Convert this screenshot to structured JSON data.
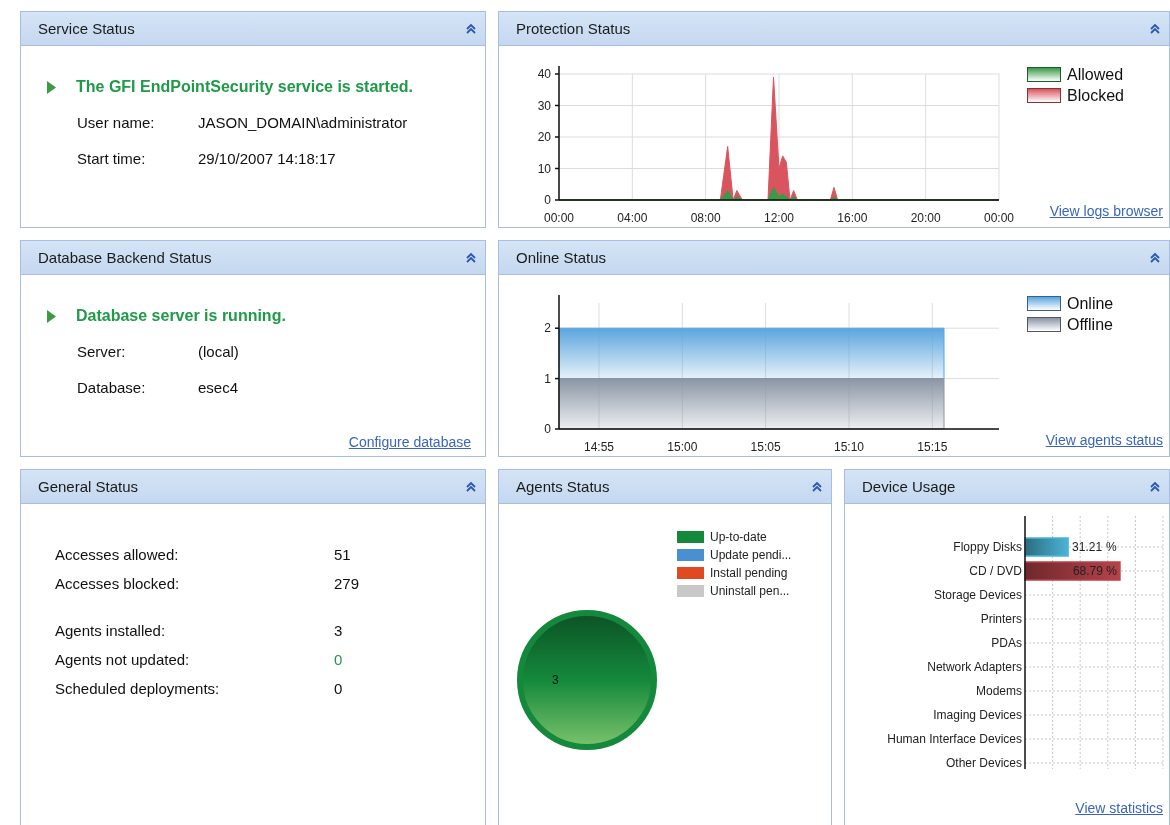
{
  "panels": [
    {
      "kind": "service",
      "title": "Service Status",
      "status_message": "The GFI EndPointSecurity service is started.",
      "fields": [
        {
          "label": "User name:",
          "value": "JASON_DOMAIN\\administrator"
        },
        {
          "label": "Start time:",
          "value": "29/10/2007 14:18:17"
        }
      ]
    },
    {
      "kind": "area_chart",
      "title": "Protection Status",
      "link": "View logs browser",
      "chart_data": {
        "type": "area",
        "grid": true,
        "x": [
          0,
          8.8,
          9.2,
          9.5,
          9.7,
          10,
          11.4,
          11.7,
          12,
          12.2,
          12.4,
          12.6,
          12.8,
          13,
          14.8,
          15,
          15.2,
          24
        ],
        "xlim": [
          0,
          24
        ],
        "ylim": [
          0,
          40
        ],
        "xticks": [
          {
            "value": 0,
            "label": "00:00"
          },
          {
            "value": 4,
            "label": "04:00"
          },
          {
            "value": 8,
            "label": "08:00"
          },
          {
            "value": 12,
            "label": "12:00"
          },
          {
            "value": 16,
            "label": "16:00"
          },
          {
            "value": 20,
            "label": "20:00"
          },
          {
            "value": 24,
            "label": "00:00"
          }
        ],
        "yticks": [
          0,
          10,
          20,
          30,
          40
        ],
        "series": [
          {
            "name": "Allowed",
            "color": "#3a9a4a",
            "values": [
              0,
              0,
              3,
              0,
              1,
              0,
              0,
              4,
              1,
              2,
              1,
              0,
              1,
              0,
              0,
              1,
              0,
              0
            ]
          },
          {
            "name": "Blocked",
            "color": "#d9545e",
            "values": [
              0,
              0,
              17,
              0,
              3,
              0,
              0,
              39,
              10,
              14,
              12,
              0,
              3,
              0,
              0,
              4,
              0,
              0
            ]
          }
        ]
      }
    },
    {
      "kind": "service",
      "title": "Database Backend Status",
      "status_message": "Database server is running.",
      "fields": [
        {
          "label": "Server:",
          "value": "(local)"
        },
        {
          "label": "Database:",
          "value": "esec4"
        }
      ],
      "link": "Configure database"
    },
    {
      "kind": "area_chart",
      "title": "Online Status",
      "link": "View agents status",
      "chart_data": {
        "type": "area",
        "grid": true,
        "x": [
          14.8767,
          15.2617
        ],
        "xlim": [
          14.8767,
          15.3167
        ],
        "ylim": [
          0,
          2.5
        ],
        "stacked": true,
        "xticks": [
          {
            "value": 14.9167,
            "label": "14:55"
          },
          {
            "value": 15,
            "label": "15:00"
          },
          {
            "value": 15.0833,
            "label": "15:05"
          },
          {
            "value": 15.1667,
            "label": "15:10"
          },
          {
            "value": 15.25,
            "label": "15:15"
          }
        ],
        "yticks": [
          0,
          1,
          2
        ],
        "series": [
          {
            "name": "Online",
            "color": "#5aa5de",
            "values": [
              1,
              1
            ]
          },
          {
            "name": "Offline",
            "color": "#8a95a5",
            "values": [
              1,
              1
            ]
          }
        ]
      }
    },
    {
      "kind": "counts",
      "title": "General Status",
      "groups": [
        [
          {
            "label": "Accesses allowed:",
            "value": "51",
            "accent": false
          },
          {
            "label": "Accesses blocked:",
            "value": "279",
            "accent": false
          }
        ],
        [
          {
            "label": "Agents installed:",
            "value": "3",
            "accent": false
          },
          {
            "label": "Agents not updated:",
            "value": "0",
            "accent": true
          },
          {
            "label": "Scheduled deployments:",
            "value": "0",
            "accent": false
          }
        ]
      ]
    },
    {
      "kind": "pie_chart",
      "title": "Agents Status",
      "legend": [
        {
          "label": "Up-to-date",
          "color": "#14893c"
        },
        {
          "label": "Update pendi...",
          "color": "#4a8fd0"
        },
        {
          "label": "Install pending",
          "color": "#e04a22"
        },
        {
          "label": "Uninstall pen...",
          "color": "#c8c8c8"
        }
      ],
      "chart_data": {
        "type": "pie",
        "data_labels": true,
        "series": [
          {
            "color": "#14893c",
            "values": [
              3
            ]
          }
        ]
      }
    },
    {
      "kind": "bar_chart",
      "title": "Device Usage",
      "link": "View statistics",
      "value_suffix": "%",
      "chart_data": {
        "type": "bar",
        "orientation": "horizontal",
        "grid": true,
        "categories": [
          "Floppy Disks",
          "CD / DVD",
          "Storage Devices",
          "Printers",
          "PDAs",
          "Network Adapters",
          "Modems",
          "Imaging Devices",
          "Human Interface Devices",
          "Other Devices"
        ],
        "series": [
          {
            "values": [
              31.21,
              68.79,
              null,
              null,
              null,
              null,
              null,
              null,
              null,
              null
            ],
            "colors": [
              "#4bb4d6",
              "#b8424a",
              null,
              null,
              null,
              null,
              null,
              null,
              null,
              null
            ]
          }
        ],
        "data_labels": true
      }
    }
  ]
}
